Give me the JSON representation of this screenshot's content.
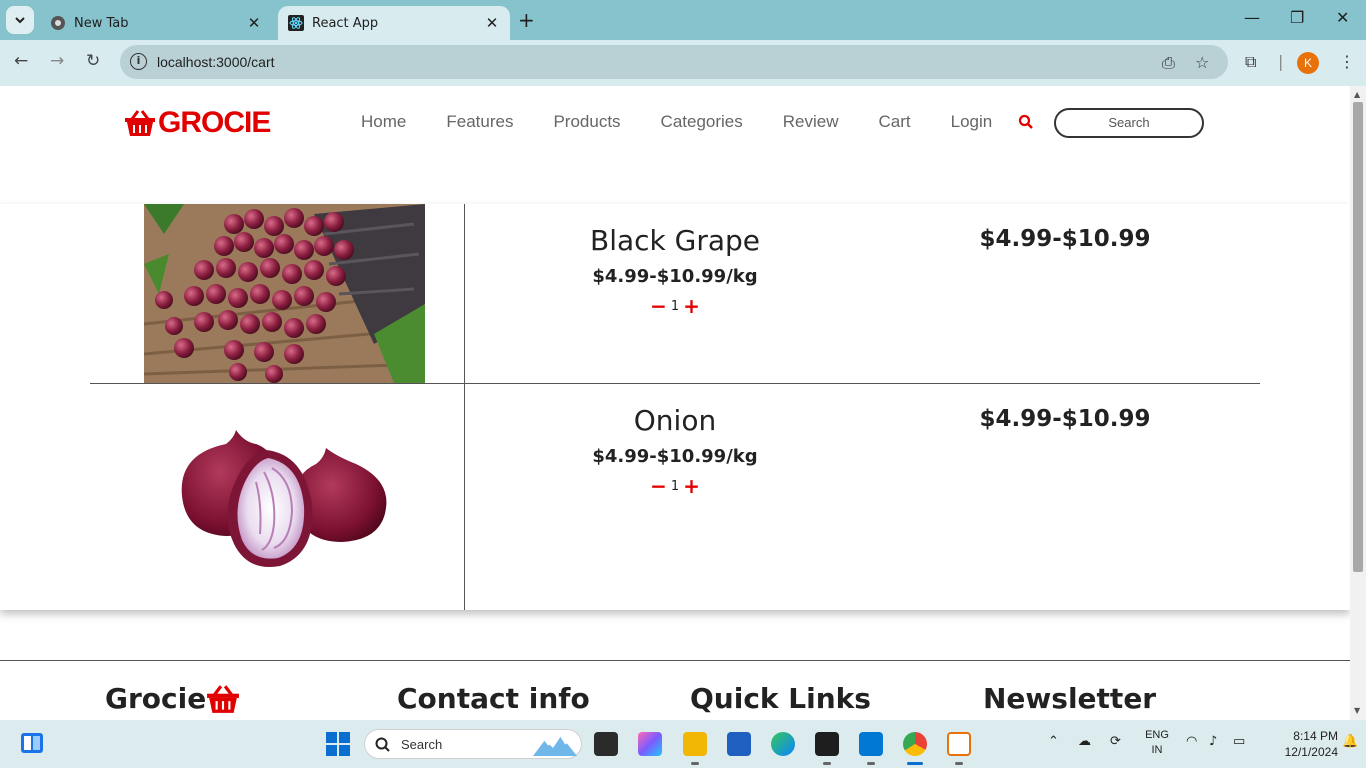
{
  "browser": {
    "tabs": [
      {
        "title": "New Tab",
        "active": false
      },
      {
        "title": "React App",
        "active": true
      }
    ],
    "url": "localhost:3000/cart",
    "profile_initial": "K"
  },
  "site": {
    "logo_text": "GROCIE",
    "nav": [
      "Home",
      "Features",
      "Products",
      "Categories",
      "Review",
      "Cart",
      "Login"
    ],
    "search_placeholder": "Search",
    "accent_color": "#e00000"
  },
  "cart": {
    "items": [
      {
        "name": "Black Grape",
        "unit_price": "$4.99-$10.99/kg",
        "quantity": "1",
        "total": "$4.99-$10.99",
        "image": "black-grapes"
      },
      {
        "name": "Onion",
        "unit_price": "$4.99-$10.99/kg",
        "quantity": "1",
        "total": "$4.99-$10.99",
        "image": "red-onions"
      }
    ]
  },
  "footer": {
    "brand": "Grocie",
    "contact_title": "Contact info",
    "links_title": "Quick Links",
    "newsletter_title": "Newsletter"
  },
  "taskbar": {
    "search_label": "Search",
    "lang": "ENG",
    "region": "IN",
    "time": "8:14 PM",
    "date": "12/1/2024"
  }
}
